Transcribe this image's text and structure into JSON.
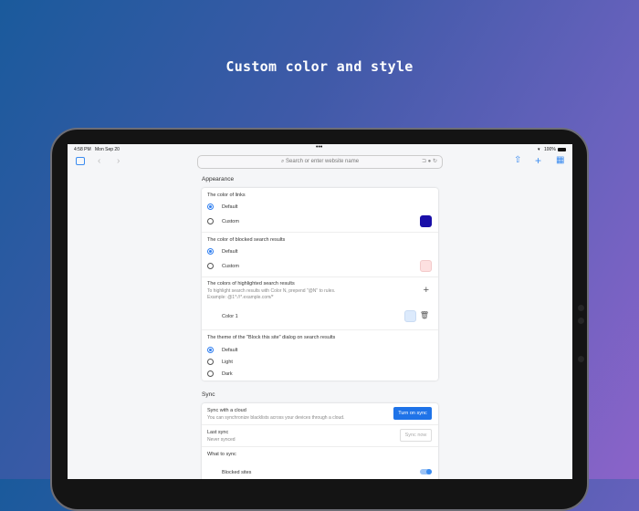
{
  "headline": "Custom color and style",
  "status": {
    "time": "4:58 PM",
    "date": "Mon Sep 20",
    "battery": "100%"
  },
  "toolbar": {
    "search_placeholder": "Search or enter website name"
  },
  "appearance": {
    "title": "Appearance",
    "links": {
      "label": "The color of links",
      "options": [
        "Default",
        "Custom"
      ],
      "selected": "Default",
      "custom_color": "#1a0fa8"
    },
    "blocked": {
      "label": "The color of blocked search results",
      "options": [
        "Default",
        "Custom"
      ],
      "selected": "Default",
      "custom_color": "#fde0e0"
    },
    "highlighted": {
      "label": "The colors of highlighted search results",
      "desc1": "To highlight search results with Color N, prepend \"@N\" to rules.",
      "desc2": "Example: @1*://*.example.com/*",
      "color1_label": "Color 1",
      "color1": "#dceafc"
    },
    "theme": {
      "label": "The theme of the \"Block this site\" dialog on search results",
      "options": [
        "Default",
        "Light",
        "Dark"
      ],
      "selected": "Default"
    }
  },
  "sync": {
    "title": "Sync",
    "cloud_label": "Sync with a cloud",
    "cloud_desc": "You can synchronize blacklists across your devices through a cloud.",
    "turn_on": "Turn on sync",
    "last_label": "Last sync",
    "last_value": "Never synced",
    "sync_now": "Sync now",
    "what_label": "What to sync",
    "blocked_sites": "Blocked sites",
    "blocked_sites_on": true
  },
  "colors": {
    "accent": "#2f7ef0"
  }
}
